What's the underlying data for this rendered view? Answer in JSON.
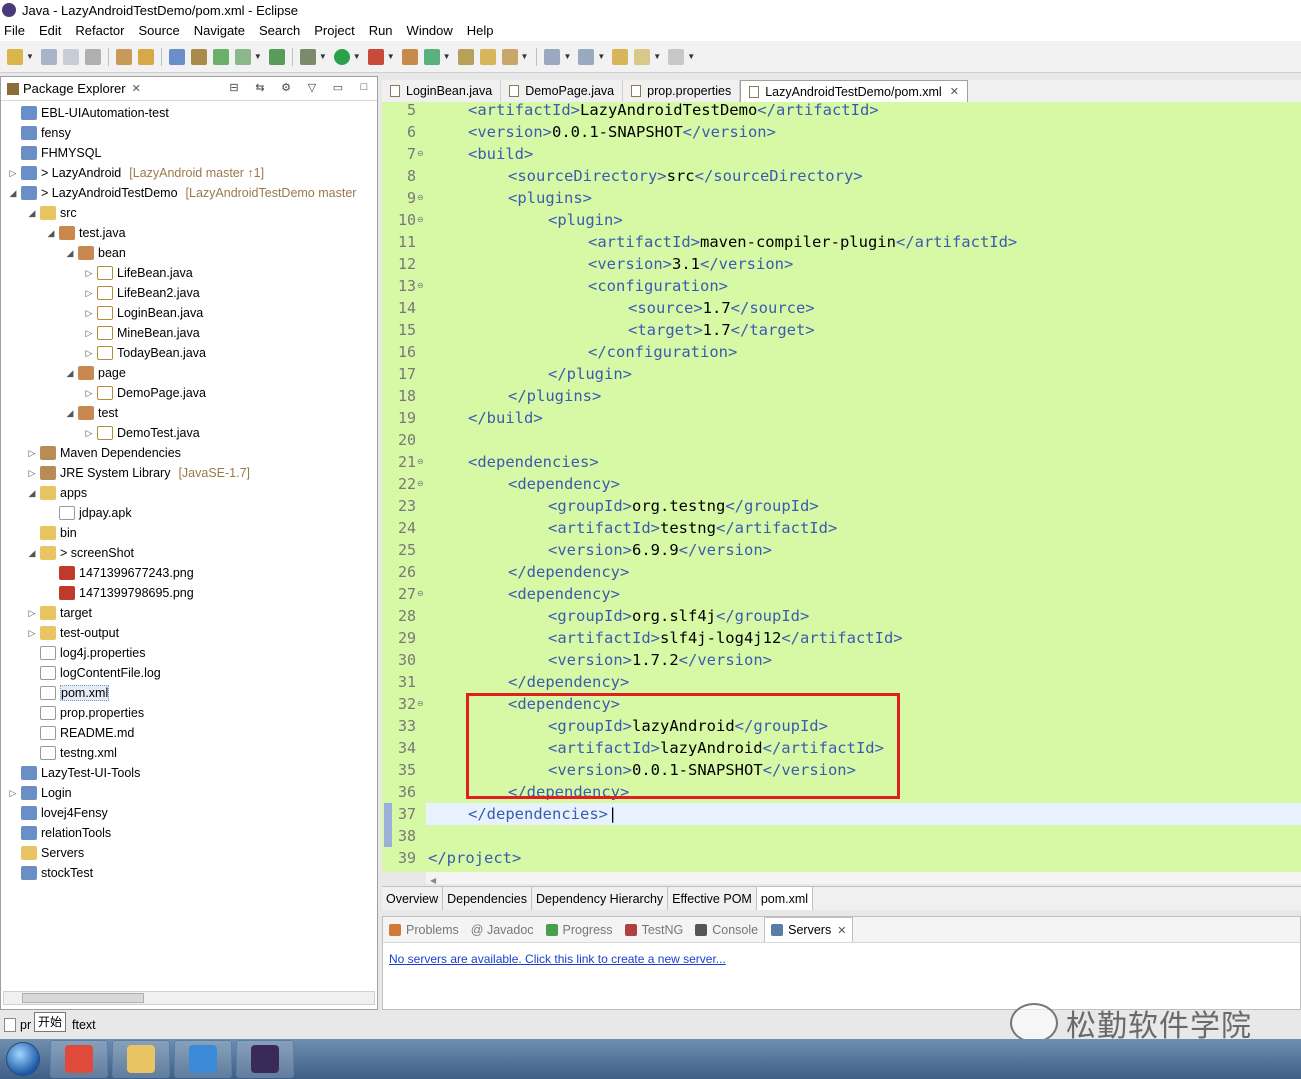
{
  "window": {
    "title": "Java - LazyAndroidTestDemo/pom.xml - Eclipse"
  },
  "menu": [
    "File",
    "Edit",
    "Refactor",
    "Source",
    "Navigate",
    "Search",
    "Project",
    "Run",
    "Window",
    "Help"
  ],
  "package_explorer": {
    "title": "Package Explorer",
    "items": [
      {
        "label": "EBL-UIAutomation-test",
        "icon": "project-icon",
        "indent": 0,
        "twisty": ""
      },
      {
        "label": "fensy",
        "icon": "project-icon",
        "indent": 0,
        "twisty": ""
      },
      {
        "label": "FHMYSQL",
        "icon": "project-icon",
        "indent": 0,
        "twisty": ""
      },
      {
        "label": "> LazyAndroid",
        "annotation": "[LazyAndroid master ↑1]",
        "icon": "maven-project-icon",
        "indent": 0,
        "twisty": "▷"
      },
      {
        "label": "> LazyAndroidTestDemo",
        "annotation": "[LazyAndroidTestDemo master",
        "icon": "maven-project-icon",
        "indent": 0,
        "twisty": "◢"
      },
      {
        "label": "src",
        "icon": "source-folder-icon",
        "indent": 1,
        "twisty": "◢"
      },
      {
        "label": "test.java",
        "icon": "package-icon",
        "indent": 2,
        "twisty": "◢"
      },
      {
        "label": "bean",
        "icon": "package-icon",
        "indent": 3,
        "twisty": "◢"
      },
      {
        "label": "LifeBean.java",
        "icon": "java-file-icon",
        "indent": 4,
        "twisty": "▷"
      },
      {
        "label": "LifeBean2.java",
        "icon": "java-file-icon",
        "indent": 4,
        "twisty": "▷"
      },
      {
        "label": "LoginBean.java",
        "icon": "java-file-icon",
        "indent": 4,
        "twisty": "▷"
      },
      {
        "label": "MineBean.java",
        "icon": "java-file-icon",
        "indent": 4,
        "twisty": "▷"
      },
      {
        "label": "TodayBean.java",
        "icon": "java-file-icon",
        "indent": 4,
        "twisty": "▷"
      },
      {
        "label": "page",
        "icon": "package-icon",
        "indent": 3,
        "twisty": "◢"
      },
      {
        "label": "DemoPage.java",
        "icon": "java-file-icon",
        "indent": 4,
        "twisty": "▷"
      },
      {
        "label": "test",
        "icon": "package-icon",
        "indent": 3,
        "twisty": "◢"
      },
      {
        "label": "DemoTest.java",
        "icon": "java-file-icon",
        "indent": 4,
        "twisty": "▷"
      },
      {
        "label": "Maven Dependencies",
        "icon": "library-icon",
        "indent": 1,
        "twisty": "▷"
      },
      {
        "label": "JRE System Library",
        "annotation": "[JavaSE-1.7]",
        "icon": "library-icon",
        "indent": 1,
        "twisty": "▷"
      },
      {
        "label": "apps",
        "icon": "folder-icon",
        "indent": 1,
        "twisty": "◢"
      },
      {
        "label": "jdpay.apk",
        "icon": "file-icon",
        "indent": 2,
        "twisty": ""
      },
      {
        "label": "bin",
        "icon": "folder-icon",
        "indent": 1,
        "twisty": ""
      },
      {
        "label": "> screenShot",
        "icon": "folder-icon",
        "indent": 1,
        "twisty": "◢"
      },
      {
        "label": "1471399677243.png",
        "icon": "image-file-icon",
        "indent": 2,
        "twisty": ""
      },
      {
        "label": "1471399798695.png",
        "icon": "image-file-icon",
        "indent": 2,
        "twisty": ""
      },
      {
        "label": "target",
        "icon": "folder-icon",
        "indent": 1,
        "twisty": "▷"
      },
      {
        "label": "test-output",
        "icon": "folder-icon",
        "indent": 1,
        "twisty": "▷"
      },
      {
        "label": "log4j.properties",
        "icon": "file-icon",
        "indent": 1,
        "twisty": ""
      },
      {
        "label": "logContentFile.log",
        "icon": "file-icon",
        "indent": 1,
        "twisty": ""
      },
      {
        "label": "pom.xml",
        "icon": "xml-file-icon",
        "indent": 1,
        "twisty": "",
        "selected": true
      },
      {
        "label": "prop.properties",
        "icon": "file-icon",
        "indent": 1,
        "twisty": ""
      },
      {
        "label": "README.md",
        "icon": "file-icon",
        "indent": 1,
        "twisty": ""
      },
      {
        "label": "testng.xml",
        "icon": "xml-file-icon",
        "indent": 1,
        "twisty": ""
      },
      {
        "label": "LazyTest-UI-Tools",
        "icon": "project-icon",
        "indent": 0,
        "twisty": ""
      },
      {
        "label": "Login",
        "icon": "maven-project-icon",
        "indent": 0,
        "twisty": "▷"
      },
      {
        "label": "lovej4Fensy",
        "icon": "project-icon",
        "indent": 0,
        "twisty": ""
      },
      {
        "label": "relationTools",
        "icon": "project-icon",
        "indent": 0,
        "twisty": ""
      },
      {
        "label": "Servers",
        "icon": "folder-icon",
        "indent": 0,
        "twisty": ""
      },
      {
        "label": "stockTest",
        "icon": "project-icon",
        "indent": 0,
        "twisty": ""
      }
    ]
  },
  "editor_tabs": [
    {
      "label": "LoginBean.java",
      "active": false
    },
    {
      "label": "DemoPage.java",
      "active": false
    },
    {
      "label": "prop.properties",
      "active": false
    },
    {
      "label": "LazyAndroidTestDemo/pom.xml",
      "active": true
    }
  ],
  "code_lines": [
    {
      "n": "5",
      "fold": "",
      "indent": 1,
      "segs": [
        [
          "tag",
          "<artifactId>"
        ],
        [
          "txt",
          "LazyAndroidTestDemo"
        ],
        [
          "tag",
          "</artifactId>"
        ]
      ]
    },
    {
      "n": "6",
      "fold": "",
      "indent": 1,
      "segs": [
        [
          "tag",
          "<version>"
        ],
        [
          "txt",
          "0.0.1-SNAPSHOT"
        ],
        [
          "tag",
          "</version>"
        ]
      ]
    },
    {
      "n": "7",
      "fold": "⊖",
      "indent": 1,
      "segs": [
        [
          "tag",
          "<build>"
        ]
      ]
    },
    {
      "n": "8",
      "fold": "",
      "indent": 2,
      "segs": [
        [
          "tag",
          "<sourceDirectory>"
        ],
        [
          "txt",
          "src"
        ],
        [
          "tag",
          "</sourceDirectory>"
        ]
      ]
    },
    {
      "n": "9",
      "fold": "⊖",
      "indent": 2,
      "segs": [
        [
          "tag",
          "<plugins>"
        ]
      ]
    },
    {
      "n": "10",
      "fold": "⊖",
      "indent": 3,
      "segs": [
        [
          "tag",
          "<plugin>"
        ]
      ]
    },
    {
      "n": "11",
      "fold": "",
      "indent": 4,
      "segs": [
        [
          "tag",
          "<artifactId>"
        ],
        [
          "txt",
          "maven-compiler-plugin"
        ],
        [
          "tag",
          "</artifactId>"
        ]
      ]
    },
    {
      "n": "12",
      "fold": "",
      "indent": 4,
      "segs": [
        [
          "tag",
          "<version>"
        ],
        [
          "txt",
          "3.1"
        ],
        [
          "tag",
          "</version>"
        ]
      ]
    },
    {
      "n": "13",
      "fold": "⊖",
      "indent": 4,
      "segs": [
        [
          "tag",
          "<configuration>"
        ]
      ]
    },
    {
      "n": "14",
      "fold": "",
      "indent": 5,
      "segs": [
        [
          "tag",
          "<source>"
        ],
        [
          "txt",
          "1.7"
        ],
        [
          "tag",
          "</source>"
        ]
      ]
    },
    {
      "n": "15",
      "fold": "",
      "indent": 5,
      "segs": [
        [
          "tag",
          "<target>"
        ],
        [
          "txt",
          "1.7"
        ],
        [
          "tag",
          "</target>"
        ]
      ]
    },
    {
      "n": "16",
      "fold": "",
      "indent": 4,
      "segs": [
        [
          "tag",
          "</configuration>"
        ]
      ]
    },
    {
      "n": "17",
      "fold": "",
      "indent": 3,
      "segs": [
        [
          "tag",
          "</plugin>"
        ]
      ]
    },
    {
      "n": "18",
      "fold": "",
      "indent": 2,
      "segs": [
        [
          "tag",
          "</plugins>"
        ]
      ]
    },
    {
      "n": "19",
      "fold": "",
      "indent": 1,
      "segs": [
        [
          "tag",
          "</build>"
        ]
      ]
    },
    {
      "n": "20",
      "fold": "",
      "indent": 0,
      "segs": []
    },
    {
      "n": "21",
      "fold": "⊖",
      "indent": 1,
      "segs": [
        [
          "tag",
          "<dependencies>"
        ]
      ]
    },
    {
      "n": "22",
      "fold": "⊖",
      "indent": 2,
      "segs": [
        [
          "tag",
          "<dependency>"
        ]
      ]
    },
    {
      "n": "23",
      "fold": "",
      "indent": 3,
      "segs": [
        [
          "tag",
          "<groupId>"
        ],
        [
          "txt",
          "org.testng"
        ],
        [
          "tag",
          "</groupId>"
        ]
      ]
    },
    {
      "n": "24",
      "fold": "",
      "indent": 3,
      "segs": [
        [
          "tag",
          "<artifactId>"
        ],
        [
          "txt",
          "testng"
        ],
        [
          "tag",
          "</artifactId>"
        ]
      ]
    },
    {
      "n": "25",
      "fold": "",
      "indent": 3,
      "segs": [
        [
          "tag",
          "<version>"
        ],
        [
          "txt",
          "6.9.9"
        ],
        [
          "tag",
          "</version>"
        ]
      ]
    },
    {
      "n": "26",
      "fold": "",
      "indent": 2,
      "segs": [
        [
          "tag",
          "</dependency>"
        ]
      ]
    },
    {
      "n": "27",
      "fold": "⊖",
      "indent": 2,
      "segs": [
        [
          "tag",
          "<dependency>"
        ]
      ]
    },
    {
      "n": "28",
      "fold": "",
      "indent": 3,
      "segs": [
        [
          "tag",
          "<groupId>"
        ],
        [
          "txt",
          "org.slf4j"
        ],
        [
          "tag",
          "</groupId>"
        ]
      ]
    },
    {
      "n": "29",
      "fold": "",
      "indent": 3,
      "segs": [
        [
          "tag",
          "<artifactId>"
        ],
        [
          "txt",
          "slf4j-log4j12"
        ],
        [
          "tag",
          "</artifactId>"
        ]
      ]
    },
    {
      "n": "30",
      "fold": "",
      "indent": 3,
      "segs": [
        [
          "tag",
          "<version>"
        ],
        [
          "txt",
          "1.7.2"
        ],
        [
          "tag",
          "</version>"
        ]
      ]
    },
    {
      "n": "31",
      "fold": "",
      "indent": 2,
      "segs": [
        [
          "tag",
          "</dependency>"
        ]
      ]
    },
    {
      "n": "32",
      "fold": "⊖",
      "indent": 2,
      "segs": [
        [
          "tag",
          "<dependency>"
        ]
      ]
    },
    {
      "n": "33",
      "fold": "",
      "indent": 3,
      "segs": [
        [
          "tag",
          "<groupId>"
        ],
        [
          "txt",
          "lazyAndroid"
        ],
        [
          "tag",
          "</groupId>"
        ]
      ]
    },
    {
      "n": "34",
      "fold": "",
      "indent": 3,
      "segs": [
        [
          "tag",
          "<artifactId>"
        ],
        [
          "txt",
          "lazyAndroid"
        ],
        [
          "tag",
          "</artifactId>"
        ]
      ]
    },
    {
      "n": "35",
      "fold": "",
      "indent": 3,
      "segs": [
        [
          "tag",
          "<version>"
        ],
        [
          "txt",
          "0.0.1-SNAPSHOT"
        ],
        [
          "tag",
          "</version>"
        ]
      ]
    },
    {
      "n": "36",
      "fold": "",
      "indent": 2,
      "segs": [
        [
          "tag",
          "</dependency>"
        ]
      ]
    },
    {
      "n": "37",
      "fold": "",
      "indent": 1,
      "segs": [
        [
          "tag",
          "</dependencies>"
        ]
      ],
      "current": true
    },
    {
      "n": "38",
      "fold": "",
      "indent": 0,
      "segs": []
    },
    {
      "n": "39",
      "fold": "",
      "indent": 0,
      "segs": [
        [
          "tag",
          "</project>"
        ]
      ]
    }
  ],
  "pom_tabs": [
    "Overview",
    "Dependencies",
    "Dependency Hierarchy",
    "Effective POM",
    "pom.xml"
  ],
  "bottom_tabs": [
    {
      "label": "Problems",
      "active": false,
      "color": "#d07a3a"
    },
    {
      "label": "@ Javadoc",
      "active": false,
      "color": ""
    },
    {
      "label": "Progress",
      "active": false,
      "color": "#4aa04a"
    },
    {
      "label": "TestNG",
      "active": false,
      "color": "#b04040"
    },
    {
      "label": "Console",
      "active": false,
      "color": "#555555"
    },
    {
      "label": "Servers",
      "active": true,
      "color": "#5a7da8"
    }
  ],
  "servers_link": "No servers are available. Click this link to create a new server...",
  "status": {
    "left": "pr",
    "tooltip": "开始",
    "right": "ftext"
  },
  "watermark": "松勤软件学院",
  "taskbar_apps": [
    {
      "name": "chrome-icon",
      "color": "#e04a3a"
    },
    {
      "name": "file-explorer-icon",
      "color": "#e8c463"
    },
    {
      "name": "ie-browser-icon",
      "color": "#3a8ad8"
    },
    {
      "name": "eclipse-javaee-icon",
      "color": "#3a2a5a"
    }
  ],
  "colors": {
    "editor_bg": "#d7f9a6",
    "tag": "#3a5cb0",
    "highlight_box": "#e02020"
  }
}
